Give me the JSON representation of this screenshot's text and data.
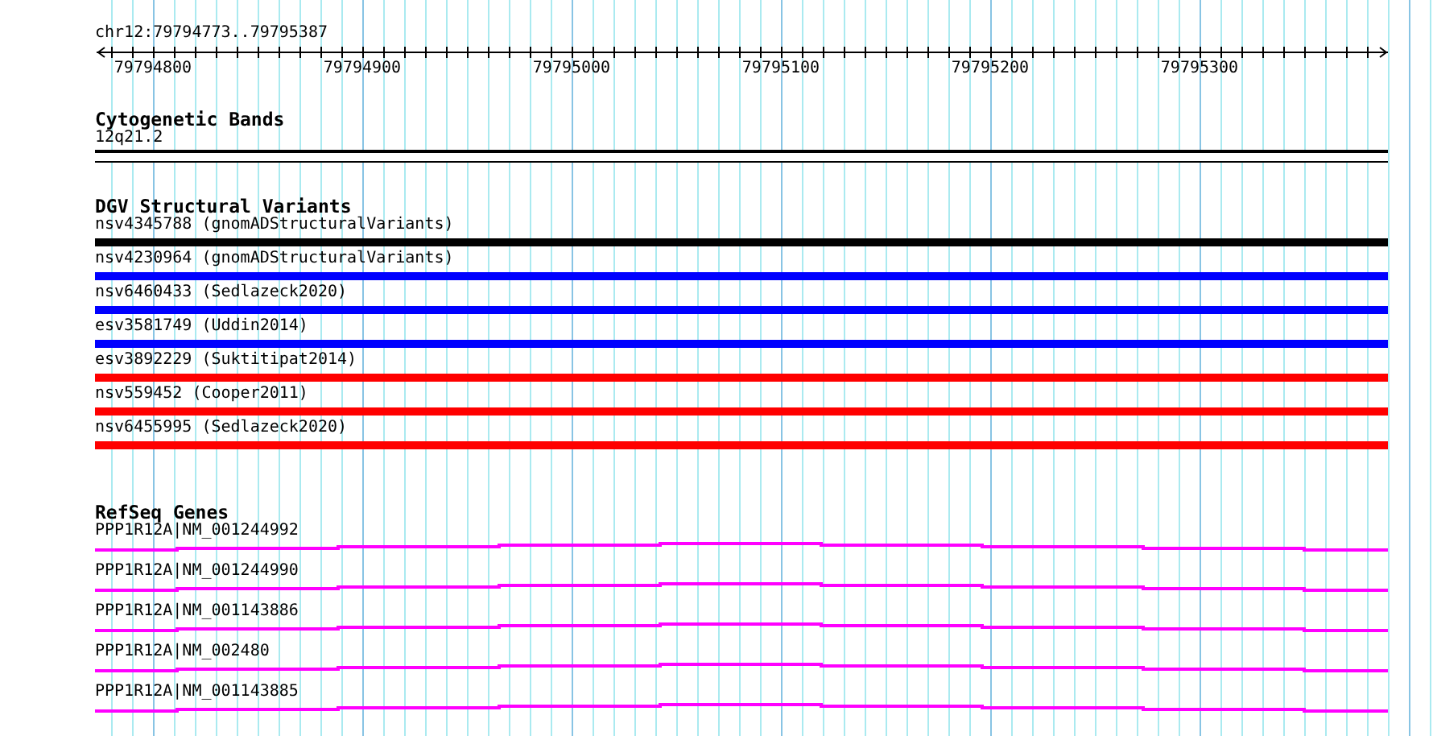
{
  "ruler": {
    "location": "chr12:79794773..79795387",
    "ticks": [
      "79794800",
      "79794900",
      "79795000",
      "79795100",
      "79795200",
      "79795300"
    ]
  },
  "cytogenetic_bands": {
    "title": "Cytogenetic Bands",
    "band": "12q21.2"
  },
  "dgv_structural_variants": {
    "title": "DGV Structural Variants",
    "items": [
      {
        "label": "nsv4345788 (gnomADStructuralVariants)",
        "color": "#000000"
      },
      {
        "label": "nsv4230964 (gnomADStructuralVariants)",
        "color": "#0000ff"
      },
      {
        "label": "nsv6460433 (Sedlazeck2020)",
        "color": "#0000ff"
      },
      {
        "label": "esv3581749 (Uddin2014)",
        "color": "#0000ff"
      },
      {
        "label": "esv3892229 (Suktitipat2014)",
        "color": "#ff0000"
      },
      {
        "label": "nsv559452 (Cooper2011)",
        "color": "#ff0000"
      },
      {
        "label": "nsv6455995 (Sedlazeck2020)",
        "color": "#ff0000"
      }
    ]
  },
  "refseq_genes": {
    "title": "RefSeq Genes",
    "items": [
      {
        "label": "PPP1R12A|NM_001244992"
      },
      {
        "label": "PPP1R12A|NM_001244990"
      },
      {
        "label": "PPP1R12A|NM_001143886"
      },
      {
        "label": "PPP1R12A|NM_002480"
      },
      {
        "label": "PPP1R12A|NM_001143885"
      }
    ]
  }
}
